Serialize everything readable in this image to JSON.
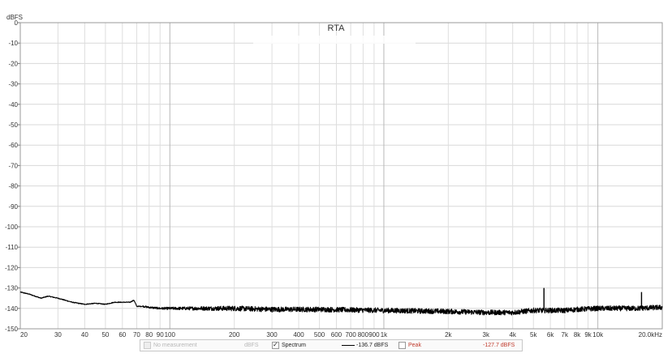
{
  "chart_data": {
    "type": "line",
    "title": "RTA",
    "ylabel": "dBFS",
    "xlabel": "",
    "x_scale": "log",
    "xlim": [
      20,
      20000
    ],
    "ylim": [
      -150,
      0
    ],
    "grid": true,
    "y_ticks": [
      0,
      -10,
      -20,
      -30,
      -40,
      -50,
      -60,
      -70,
      -80,
      -90,
      -100,
      -110,
      -120,
      -130,
      -140,
      -150
    ],
    "y_tick_labels": [
      "0",
      "-10",
      "-20",
      "-30",
      "-40",
      "-50",
      "-60",
      "-70",
      "-80",
      "-90",
      "-100",
      "-110",
      "-120",
      "-130",
      "-140",
      "-150"
    ],
    "x_ticks": [
      20,
      30,
      40,
      50,
      60,
      70,
      80,
      90,
      100,
      200,
      300,
      400,
      500,
      600,
      700,
      800,
      900,
      1000,
      2000,
      3000,
      4000,
      5000,
      6000,
      7000,
      8000,
      9000,
      10000,
      20000
    ],
    "x_tick_labels": [
      "20",
      "30",
      "40",
      "50",
      "60",
      "70",
      "80",
      "90",
      "100",
      "200",
      "300",
      "400",
      "500",
      "600",
      "700",
      "800",
      "900",
      "1k",
      "2k",
      "3k",
      "4k",
      "5k",
      "6k",
      "7k",
      "8k",
      "9k",
      "10k",
      "20.0kHz"
    ],
    "series": [
      {
        "name": "Spectrum",
        "color": "#000000",
        "x": [
          20,
          22,
          25,
          27,
          30,
          35,
          40,
          45,
          50,
          55,
          60,
          65,
          68,
          70,
          75,
          80,
          90,
          100,
          120,
          150,
          200,
          300,
          500,
          1000,
          2000,
          3000,
          4000,
          5000,
          6000,
          7000,
          8000,
          10000,
          15000,
          20000
        ],
        "values": [
          -132,
          -133,
          -135,
          -134,
          -135,
          -137,
          -138,
          -137.5,
          -138,
          -137,
          -137,
          -137,
          -136,
          -139,
          -139,
          -139.5,
          -140,
          -140,
          -140,
          -140,
          -140,
          -140.5,
          -140.5,
          -141,
          -141.5,
          -142,
          -142,
          -141,
          -141,
          -141,
          -140.5,
          -140,
          -140,
          -139.5
        ],
        "noise_db": 2.5,
        "peaks": [
          {
            "x": 5600,
            "y": -130
          },
          {
            "x": 16000,
            "y": -132
          }
        ]
      }
    ]
  },
  "legend": {
    "no_measurement_label": "No measurement",
    "unit_label": "dBFS",
    "spectrum_label": "Spectrum",
    "spectrum_value": "-136.7 dBFS",
    "peak_label": "Peak",
    "peak_value": "-127.7 dBFS",
    "peak_color": "#c0392b"
  }
}
